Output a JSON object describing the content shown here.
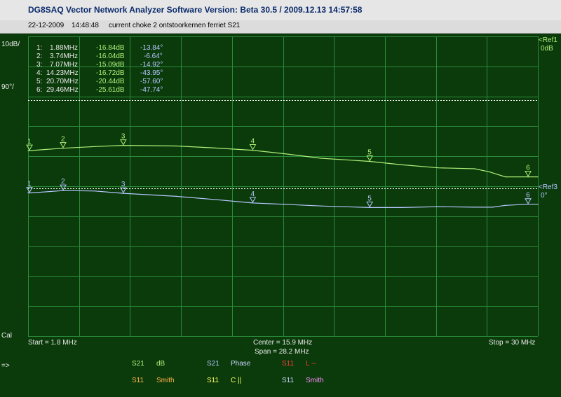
{
  "window": {
    "title": "DG8SAQ Vector Network Analyzer Software   Version:  Beta 30.5 / 2009.12.13 14:57:58",
    "date": "22-12-2009",
    "time": "14:48:48",
    "note": "current choke 2 ontstoorkernen ferriet S21"
  },
  "axis": {
    "left_top": "10dB/",
    "left_mid": "90°/",
    "ref1": "<Ref1",
    "ref1_val": "0dB",
    "ref3": "<Ref3",
    "ref3_val": "0°",
    "cal": "Cal",
    "start": "Start = 1.8 MHz",
    "center": "Center = 15.9 MHz",
    "span": "Span = 28.2 MHz",
    "stop": "Stop = 30 MHz"
  },
  "markers": [
    {
      "idx": "1:",
      "freq": "1.88MHz",
      "db": "-16.84dB",
      "phase": "-13.84°"
    },
    {
      "idx": "2:",
      "freq": "3.74MHz",
      "db": "-16.04dB",
      "phase": "-6.64°"
    },
    {
      "idx": "3:",
      "freq": "7.07MHz",
      "db": "-15.09dB",
      "phase": "-14.92°"
    },
    {
      "idx": "4:",
      "freq": "14.23MHz",
      "db": "-16.72dB",
      "phase": "-43.95°"
    },
    {
      "idx": "5:",
      "freq": "20.70MHz",
      "db": "-20.44dB",
      "phase": "-57.60°"
    },
    {
      "idx": "6:",
      "freq": "29.46MHz",
      "db": "-25.61dB",
      "phase": "-47.74°"
    }
  ],
  "legend": {
    "arrow": "=>",
    "r1": [
      {
        "a": "S21",
        "b": "dB"
      },
      {
        "a": "S21",
        "b": "Phase"
      },
      {
        "a": "S11",
        "b": "L --"
      }
    ],
    "r2": [
      {
        "a": "S11",
        "b": "Smith"
      },
      {
        "a": "S11",
        "b": "C ||"
      },
      {
        "a": "S11",
        "b": "Smith"
      }
    ]
  },
  "chart_data": {
    "type": "line",
    "x_range_mhz": [
      1.8,
      30
    ],
    "grid": true,
    "series": [
      {
        "name": "dB",
        "color": "#aef07a",
        "ref_value": 0,
        "units_per_div": 10,
        "x": [
          1.8,
          1.88,
          3.74,
          5.5,
          7.07,
          10.0,
          12.0,
          14.23,
          16.0,
          18.0,
          20.7,
          22.5,
          24.5,
          26.5,
          27.3,
          28.2,
          29.46,
          30.0
        ],
        "y": [
          -16.9,
          -16.84,
          -16.04,
          -15.5,
          -15.09,
          -15.3,
          -15.9,
          -16.72,
          -17.9,
          -19.4,
          -20.44,
          -21.6,
          -22.6,
          -22.9,
          -23.9,
          -25.6,
          -25.61,
          -25.6
        ]
      },
      {
        "name": "Phase",
        "color": "#b7c6ff",
        "ref_value": 0,
        "units_per_div": 90,
        "x": [
          1.8,
          1.88,
          3.74,
          5.5,
          7.07,
          10.0,
          12.0,
          14.23,
          16.0,
          18.0,
          20.7,
          22.5,
          24.5,
          26.5,
          27.5,
          28.2,
          29.46,
          30.0
        ],
        "y": [
          -12.0,
          -13.84,
          -6.64,
          -8.0,
          -14.92,
          -24.0,
          -33.0,
          -43.95,
          -48.0,
          -53.0,
          -57.6,
          -57.6,
          -55.0,
          -56.5,
          -56.5,
          -51.0,
          -47.74,
          -47.7
        ]
      }
    ]
  }
}
